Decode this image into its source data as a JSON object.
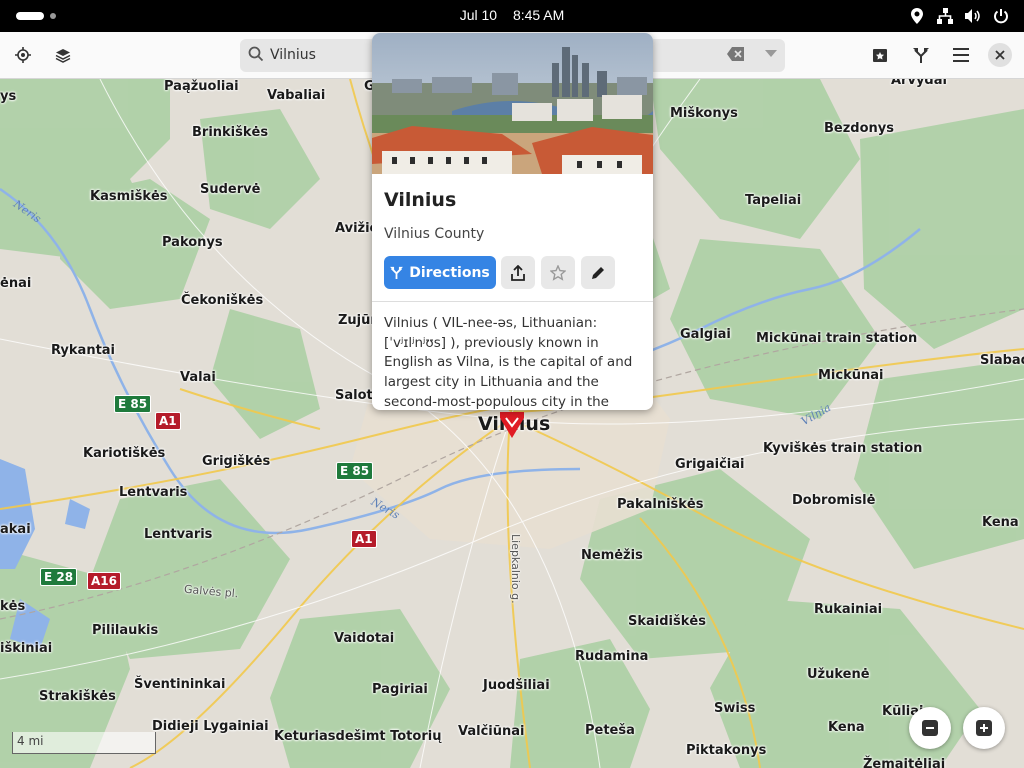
{
  "system_bar": {
    "date": "Jul 10",
    "time": "8:45 AM",
    "icons": [
      "location-icon",
      "network-icon",
      "volume-icon",
      "power-icon"
    ]
  },
  "header": {
    "left_buttons": [
      "my-location-icon",
      "layers-icon"
    ],
    "search": {
      "value": "Vilnius",
      "placeholder": ""
    },
    "right_buttons": [
      "favorites-icon",
      "route-icon",
      "menu-icon",
      "close-icon"
    ]
  },
  "popover": {
    "title": "Vilnius",
    "subtitle": "Vilnius County",
    "directions_label": "Directions",
    "action_icons": [
      "share-icon",
      "star-icon",
      "edit-icon"
    ],
    "description": "Vilnius ( VIL-nee-əs, Lithuanian: [ˈvʲɪlʲnʲʊs] ), previously known in English as Vilna, is the capital of and largest city in Lithuania and the second-most-populous city in the Baltic states. The"
  },
  "map": {
    "places": [
      {
        "name": "Paąžuoliai",
        "cls": ""
      },
      {
        "name": "Vabaliai",
        "cls": ""
      },
      {
        "name": "Miškonys",
        "cls": ""
      },
      {
        "name": "Arvydai",
        "cls": ""
      },
      {
        "name": "Bezdonys",
        "cls": ""
      },
      {
        "name": "Brinkiškės",
        "cls": ""
      },
      {
        "name": "Kasmiškės",
        "cls": ""
      },
      {
        "name": "Sudervė",
        "cls": ""
      },
      {
        "name": "Tapeliai",
        "cls": ""
      },
      {
        "name": "Pakonys",
        "cls": ""
      },
      {
        "name": "Avižie",
        "cls": ""
      },
      {
        "name": "Čekoniškės",
        "cls": ""
      },
      {
        "name": "Zujūn",
        "cls": ""
      },
      {
        "name": "Galgiai",
        "cls": ""
      },
      {
        "name": "Mickūnai train station",
        "cls": ""
      },
      {
        "name": "Slabad",
        "cls": ""
      },
      {
        "name": "Rykantai",
        "cls": ""
      },
      {
        "name": "Valai",
        "cls": ""
      },
      {
        "name": "Mickūnai",
        "cls": ""
      },
      {
        "name": "Salotė",
        "cls": ""
      },
      {
        "name": "Vilnius",
        "cls": "city"
      },
      {
        "name": "Kariotiškės",
        "cls": ""
      },
      {
        "name": "Grigiškės",
        "cls": ""
      },
      {
        "name": "Grigaičiai",
        "cls": ""
      },
      {
        "name": "Kyviškės train station",
        "cls": ""
      },
      {
        "name": "Lentvaris",
        "cls": ""
      },
      {
        "name": "Pakalniškės",
        "cls": ""
      },
      {
        "name": "Dobromislė",
        "cls": ""
      },
      {
        "name": "Lentvaris",
        "cls": ""
      },
      {
        "name": "Kena",
        "cls": ""
      },
      {
        "name": "akai",
        "cls": ""
      },
      {
        "name": "Nemėžis",
        "cls": ""
      },
      {
        "name": "ėnai",
        "cls": ""
      },
      {
        "name": "ys",
        "cls": ""
      },
      {
        "name": "Pililaukis",
        "cls": ""
      },
      {
        "name": "Skaidiškės",
        "cls": ""
      },
      {
        "name": "Rukainiai",
        "cls": ""
      },
      {
        "name": "Vaidotai",
        "cls": ""
      },
      {
        "name": "iškiniai",
        "cls": ""
      },
      {
        "name": "Rudamina",
        "cls": ""
      },
      {
        "name": "Užukenė",
        "cls": ""
      },
      {
        "name": "Šventininkai",
        "cls": ""
      },
      {
        "name": "Pagiriai",
        "cls": ""
      },
      {
        "name": "Juodšiliai",
        "cls": ""
      },
      {
        "name": "Strakiškės",
        "cls": ""
      },
      {
        "name": "Swiss",
        "cls": ""
      },
      {
        "name": "Kūliai",
        "cls": ""
      },
      {
        "name": "Didieji Lygainiai",
        "cls": ""
      },
      {
        "name": "Kena",
        "cls": ""
      },
      {
        "name": "Keturiasdešimt Totorių",
        "cls": ""
      },
      {
        "name": "Valčiūnai",
        "cls": ""
      },
      {
        "name": "Peteša",
        "cls": ""
      },
      {
        "name": "Piktakonys",
        "cls": ""
      },
      {
        "name": "Žemaitėliai",
        "cls": ""
      },
      {
        "name": "kės",
        "cls": ""
      },
      {
        "name": "G",
        "cls": ""
      }
    ],
    "shields": [
      {
        "label": "E 85",
        "color": "green"
      },
      {
        "label": "A1",
        "color": "red"
      },
      {
        "label": "E 85",
        "color": "green"
      },
      {
        "label": "A1",
        "color": "red"
      },
      {
        "label": "E 28",
        "color": "green"
      },
      {
        "label": "A16",
        "color": "red"
      }
    ],
    "water_labels": [
      "Neris",
      "Neris",
      "Vilnia"
    ],
    "street_labels": [
      "Liepkalnio g.",
      "Galvės pl."
    ],
    "scale_label": "4 mi",
    "zoom_out": "minus-icon",
    "zoom_in": "plus-icon"
  }
}
